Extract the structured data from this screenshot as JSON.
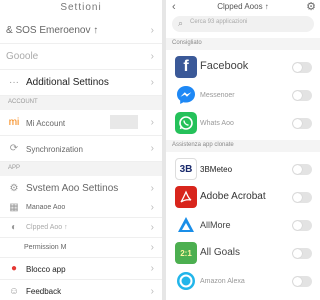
{
  "settings": {
    "title": "Settioni",
    "items_top": [
      {
        "label": "& SOS Emeroenov ↑"
      },
      {
        "label": "Gooole"
      },
      {
        "label": "Additional Settinos"
      }
    ],
    "section_account": "ACCOUNT",
    "account_items": [
      {
        "label": "Mi Account"
      },
      {
        "label": "Synchronization"
      }
    ],
    "section_app": "APP",
    "app_items": [
      {
        "label": "Svstem Aoo Settinos"
      },
      {
        "label": "Manaoe Aoo"
      },
      {
        "label": "Clpped Aoo ↑"
      },
      {
        "label": "Permission M"
      },
      {
        "label": "Blocco app"
      }
    ],
    "feedback": "Feedback"
  },
  "cloned_apps": {
    "title": "Clpped Aoos ↑",
    "search_placeholder": "Cerca 93 applicazioni",
    "section_suggested": "Consigliato",
    "suggested": [
      {
        "name": "Facebook",
        "icon": "facebook-icon",
        "color": "#3b5998"
      },
      {
        "name": "Messenoer",
        "icon": "messenger-icon",
        "color": "#1e88f5"
      },
      {
        "name": "Whats Aoo",
        "icon": "whatsapp-icon",
        "color": "#25c15a"
      }
    ],
    "section_supported": "Assistenza app clonate",
    "supported": [
      {
        "name": "3BMeteo",
        "icon": "3bmeteo-icon",
        "color": "#1a2a6c",
        "icon_text": "3B"
      },
      {
        "name": "Adobe Acrobat",
        "icon": "adobe-acrobat-icon",
        "color": "#d8251c"
      },
      {
        "name": "AllMore",
        "icon": "allmore-icon",
        "color": "#1a8ee8"
      },
      {
        "name": "All Goals",
        "icon": "all-goals-icon",
        "color": "#4caf50",
        "icon_text": "2:1"
      },
      {
        "name": "Amazon Alexa",
        "icon": "amazon-alexa-icon",
        "color": "#21b5ea"
      }
    ]
  }
}
